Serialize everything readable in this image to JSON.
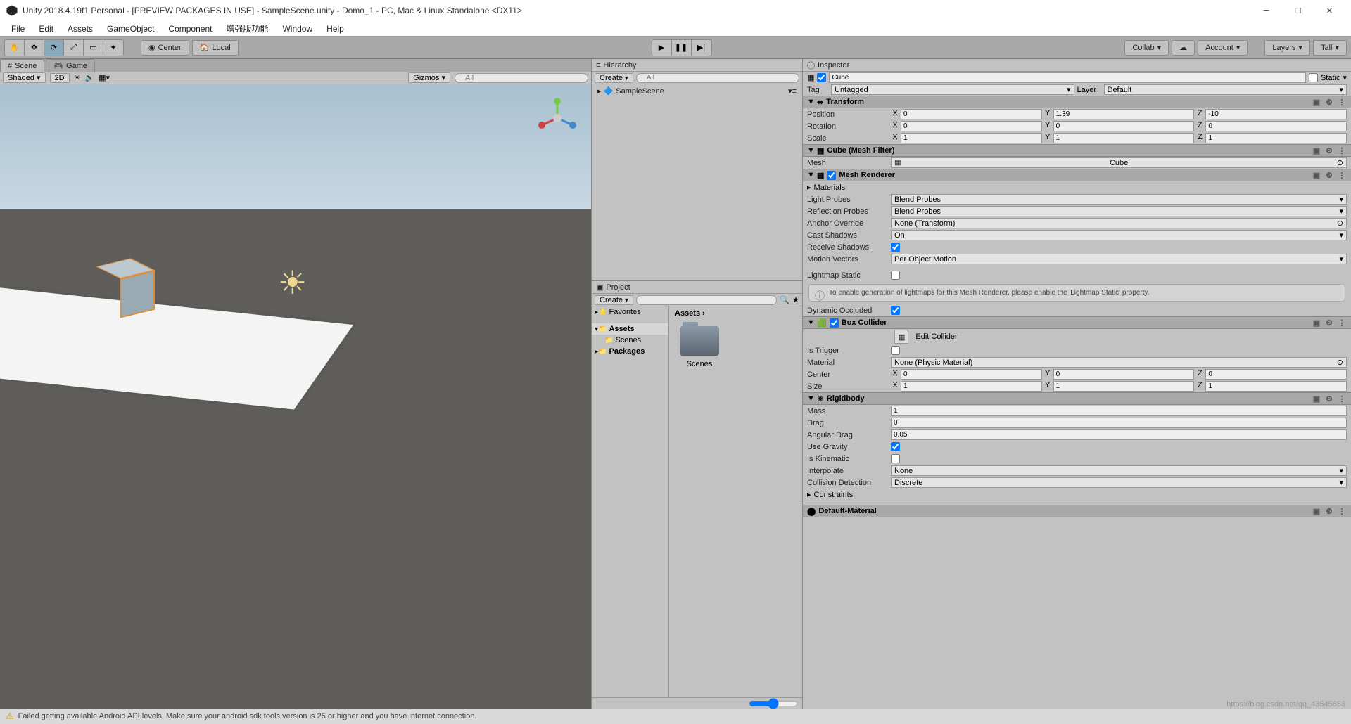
{
  "window": {
    "title": "Unity 2018.4.19f1 Personal - [PREVIEW PACKAGES IN USE] - SampleScene.unity - Domo_1 - PC, Mac & Linux Standalone <DX11>"
  },
  "menu": [
    "File",
    "Edit",
    "Assets",
    "GameObject",
    "Component",
    "增强版功能",
    "Window",
    "Help"
  ],
  "toolbar": {
    "pivot": "Center",
    "space": "Local",
    "collab": "Collab",
    "account": "Account",
    "layers": "Layers",
    "layout": "Tall"
  },
  "scene": {
    "tab_scene": "Scene",
    "tab_game": "Game",
    "shading": "Shaded",
    "mode2d": "2D",
    "gizmos": "Gizmos",
    "search_placeholder": "All"
  },
  "hierarchy": {
    "title": "Hierarchy",
    "create": "Create",
    "search_placeholder": "All",
    "root": "SampleScene"
  },
  "project": {
    "title": "Project",
    "create": "Create",
    "favorites": "Favorites",
    "assets": "Assets",
    "scenes": "Scenes",
    "packages": "Packages",
    "breadcrumb": "Assets",
    "folder": "Scenes"
  },
  "inspector": {
    "title": "Inspector",
    "obj_name": "Cube",
    "static": "Static",
    "tag_label": "Tag",
    "tag": "Untagged",
    "layer_label": "Layer",
    "layer": "Default",
    "transform": {
      "title": "Transform",
      "position": {
        "label": "Position",
        "x": "0",
        "y": "1.39",
        "z": "-10"
      },
      "rotation": {
        "label": "Rotation",
        "x": "0",
        "y": "0",
        "z": "0"
      },
      "scale": {
        "label": "Scale",
        "x": "1",
        "y": "1",
        "z": "1"
      }
    },
    "meshfilter": {
      "title": "Cube (Mesh Filter)",
      "mesh_label": "Mesh",
      "mesh": "Cube"
    },
    "renderer": {
      "title": "Mesh Renderer",
      "materials": "Materials",
      "lightprobes_label": "Light Probes",
      "lightprobes": "Blend Probes",
      "reflprobes_label": "Reflection Probes",
      "reflprobes": "Blend Probes",
      "anchor_label": "Anchor Override",
      "anchor": "None (Transform)",
      "cast_label": "Cast Shadows",
      "cast": "On",
      "recv_label": "Receive Shadows",
      "motion_label": "Motion Vectors",
      "motion": "Per Object Motion",
      "lmstatic_label": "Lightmap Static",
      "info": "To enable generation of lightmaps for this Mesh Renderer, please enable the 'Lightmap Static' property.",
      "dynocc_label": "Dynamic Occluded"
    },
    "collider": {
      "title": "Box Collider",
      "edit": "Edit Collider",
      "trigger_label": "Is Trigger",
      "material_label": "Material",
      "material": "None (Physic Material)",
      "center": {
        "label": "Center",
        "x": "0",
        "y": "0",
        "z": "0"
      },
      "size": {
        "label": "Size",
        "x": "1",
        "y": "1",
        "z": "1"
      }
    },
    "rigidbody": {
      "title": "Rigidbody",
      "mass_label": "Mass",
      "mass": "1",
      "drag_label": "Drag",
      "drag": "0",
      "angdrag_label": "Angular Drag",
      "angdrag": "0.05",
      "gravity_label": "Use Gravity",
      "kinematic_label": "Is Kinematic",
      "interp_label": "Interpolate",
      "interp": "None",
      "coll_label": "Collision Detection",
      "coll": "Discrete",
      "constraints": "Constraints"
    },
    "material": "Default-Material"
  },
  "status": {
    "msg": "Failed getting available Android API levels. Make sure your android sdk tools version is 25 or higher and you have internet connection."
  },
  "watermark": "https://blog.csdn.net/qq_43545653"
}
